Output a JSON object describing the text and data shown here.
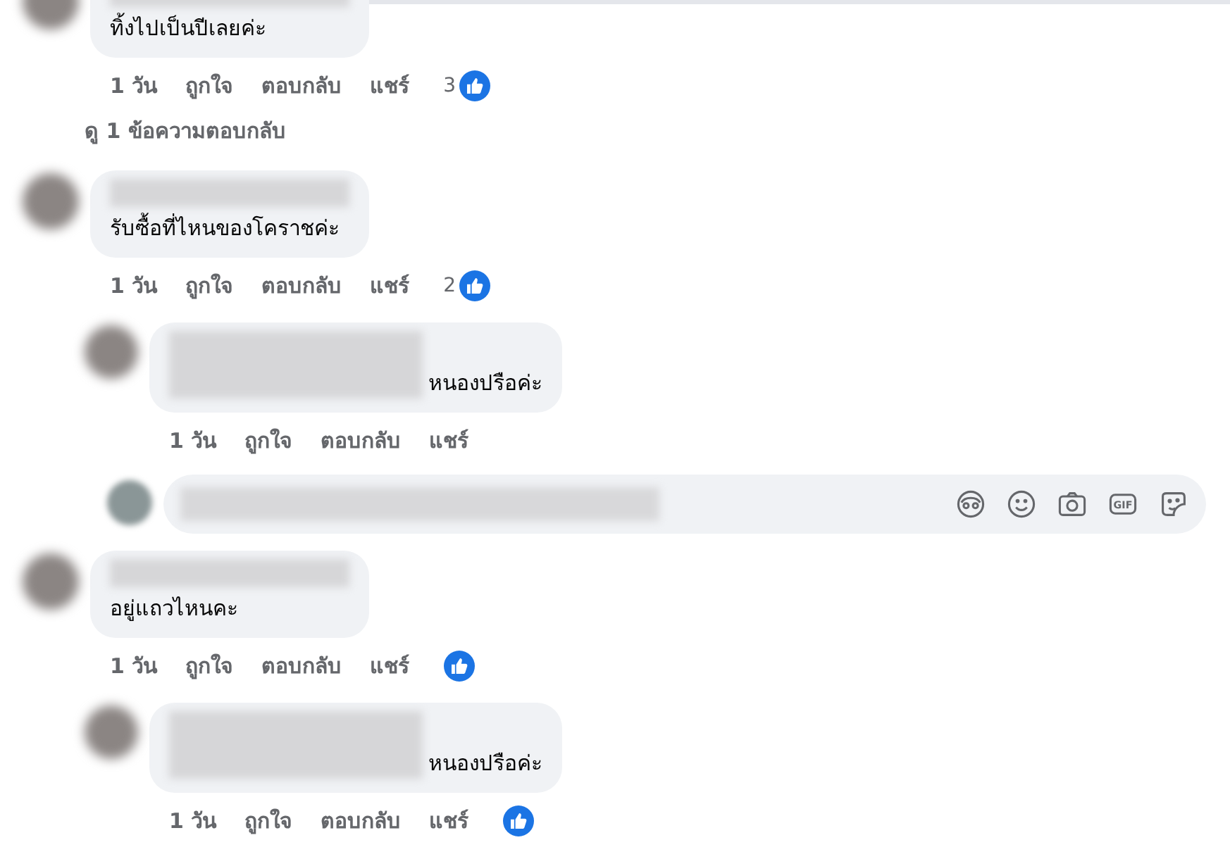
{
  "comments": [
    {
      "text": "ทิ้งไปเป็นปีเลยค่ะ",
      "actions": [
        "1 วัน",
        "ถูกใจ",
        "ตอบกลับ",
        "แชร์"
      ],
      "reacted": true,
      "reaction_count": "3",
      "view_replies": "ดู 1 ข้อความตอบกลับ"
    },
    {
      "text": "รับซื้อที่ไหนของโคราชค่ะ",
      "actions": [
        "1 วัน",
        "ถูกใจ",
        "ตอบกลับ",
        "แชร์"
      ],
      "reacted": true,
      "reaction_count": "2",
      "children": [
        {
          "text": "หนองปรือค่ะ",
          "actions": [
            "1 วัน",
            "ถูกใจ",
            "ตอบกลับ",
            "แชร์"
          ],
          "reacted": false
        }
      ],
      "reply_box": {
        "icons": [
          {
            "kind": "avatar"
          },
          {
            "kind": "emoji"
          },
          {
            "kind": "camera"
          },
          {
            "kind": "gif",
            "label": "GIF"
          },
          {
            "kind": "sticker"
          }
        ]
      }
    },
    {
      "text": "อยู่แถวไหนคะ",
      "actions": [
        "1 วัน",
        "ถูกใจ",
        "ตอบกลับ",
        "แชร์"
      ],
      "reacted": true,
      "children": [
        {
          "text": "หนองปรือค่ะ",
          "actions": [
            "1 วัน",
            "ถูกใจ",
            "ตอบกลับ",
            "แชร์"
          ],
          "reacted": true
        }
      ]
    }
  ]
}
